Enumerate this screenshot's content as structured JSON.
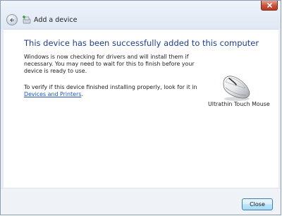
{
  "window": {
    "title": "Add a device"
  },
  "main": {
    "heading": "This device has been successfully added to this computer",
    "paragraph1": "Windows is now checking for drivers and will install them if necessary. You may need to wait for this to finish before your device is ready to use.",
    "paragraph2_prefix": "To verify if this device finished installing properly, look for it in",
    "paragraph2_link": "Devices and Printers",
    "paragraph2_suffix": "."
  },
  "device": {
    "name": "Ultrathin Touch Mouse",
    "icon": "mouse-icon"
  },
  "footer": {
    "close_label": "Close"
  },
  "colors": {
    "heading": "#1e3f8f",
    "link": "#1a53b5",
    "close_button_border": "#3c7fb1",
    "title_close_red": "#c7503a"
  }
}
